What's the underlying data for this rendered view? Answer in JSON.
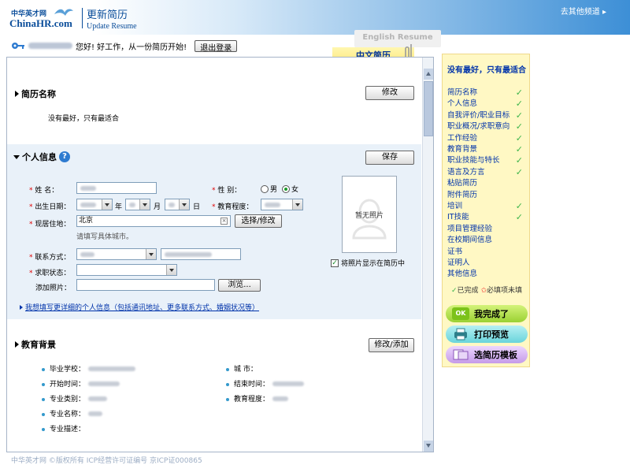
{
  "header": {
    "logo_cn": "中华英才网",
    "logo_en": "ChinaHR.com",
    "title_cn": "更新简历",
    "title_en": "Update Resume",
    "other_channel": "去其他频道 ▸"
  },
  "userbar": {
    "greeting": "您好!  好工作，从一份简历开始!",
    "logout": "退出登录"
  },
  "tabs": {
    "english": "English Resume",
    "chinese": "中文简历"
  },
  "resume_name": {
    "title": "简历名称",
    "edit_btn": "修改",
    "value": "没有最好，只有最适合"
  },
  "personal": {
    "title": "个人信息",
    "help": "?",
    "save_btn": "保存",
    "name_label": "姓    名：",
    "gender_label": "性    别：",
    "gender_male": "男",
    "gender_female": "女",
    "birth_label": "出生日期：",
    "year": "年",
    "month": "月",
    "day": "日",
    "education_label": "教育程度：",
    "residence_label": "现居住地：",
    "residence_value": "北京",
    "select_btn": "选择/修改",
    "residence_hint": "请填写具体城市。",
    "contact_label": "联系方式：",
    "job_status_label": "求职状态：",
    "photo_label": "添加照片：",
    "browse_btn": "浏览...",
    "no_photo": "暂无照片",
    "show_photo": "将照片显示在简历中",
    "more_link": "我想填写更详细的个人信息（包括通讯地址、更多联系方式、婚姻状况等）"
  },
  "education": {
    "title": "教育背景",
    "edit_btn": "修改/添加",
    "school": "毕业学校：",
    "city": "城    市：",
    "start": "开始时间：",
    "end": "结束时间：",
    "major_cat": "专业类别：",
    "degree": "教育程度：",
    "major_name": "专业名称：",
    "major_desc": "专业描述："
  },
  "sidebar": {
    "head": "没有最好，只有最适合",
    "items": [
      {
        "label": "简历名称",
        "done": true
      },
      {
        "label": "个人信息",
        "done": true
      },
      {
        "label": "自我评价/职业目标",
        "done": true
      },
      {
        "label": "职业概况/求职意向",
        "done": true
      },
      {
        "label": "工作经验",
        "done": true
      },
      {
        "label": "教育背景",
        "done": true
      },
      {
        "label": "职业技能与特长",
        "done": true
      },
      {
        "label": "语言及方言",
        "done": true
      },
      {
        "label": "粘贴简历",
        "done": false
      },
      {
        "label": "附件简历",
        "done": false
      },
      {
        "label": "培训",
        "done": true
      },
      {
        "label": "IT技能",
        "done": true
      },
      {
        "label": "项目管理经验",
        "done": false
      },
      {
        "label": "在校期间信息",
        "done": false
      },
      {
        "label": "证书",
        "done": false
      },
      {
        "label": "证明人",
        "done": false
      },
      {
        "label": "其他信息",
        "done": false
      }
    ],
    "legend_done": "已完成",
    "legend_req": "必填项未填",
    "btn_done": "我完成了",
    "btn_print": "打印预览",
    "btn_template": "选简历模板",
    "ok_icon": "OK"
  },
  "footer": "中华英才网 ©版权所有    ICP经营许可证编号  京ICP证000865"
}
